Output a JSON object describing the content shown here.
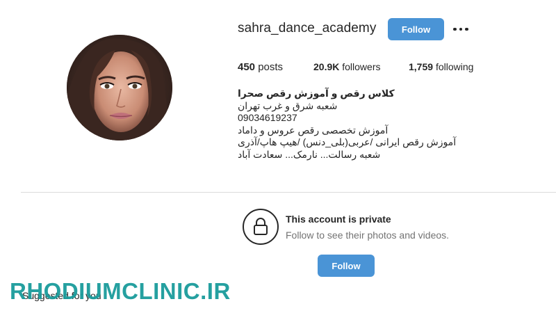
{
  "profile": {
    "username": "sahra_dance_academy",
    "follow_button_label": "Follow",
    "more_options_icon": "more-horizontal-icon",
    "avatar_icon": "profile-photo"
  },
  "stats": {
    "posts_count": "450",
    "posts_label": "posts",
    "followers_count": "20.9K",
    "followers_label": "followers",
    "following_count": "1,759",
    "following_label": "following"
  },
  "bio": {
    "name": "کلاس رقص و آموزش رقص صحرا",
    "lines": [
      "شعبه شرق و غرب تهران",
      "09034619237",
      "آموزش تخصصی رقص عروس و داماد",
      "آموزش رقص ایرانی /عربی(بلی_دنس) /هیپ هاپ/آذری",
      "شعبه رسالت... نارمک... سعادت آباد"
    ]
  },
  "private": {
    "icon": "lock-icon",
    "title": "This account is private",
    "subtitle": "Follow to see their photos and videos.",
    "follow_button_label": "Follow"
  },
  "suggested": {
    "label": "Suggested for you"
  },
  "watermark": {
    "text": "RHODIUMCLINIC.IR"
  },
  "colors": {
    "primary_button": "#4a94d6",
    "text": "#262626",
    "secondary_text": "#737373",
    "divider": "#dbdbdb",
    "watermark": "#1a9b9b"
  }
}
